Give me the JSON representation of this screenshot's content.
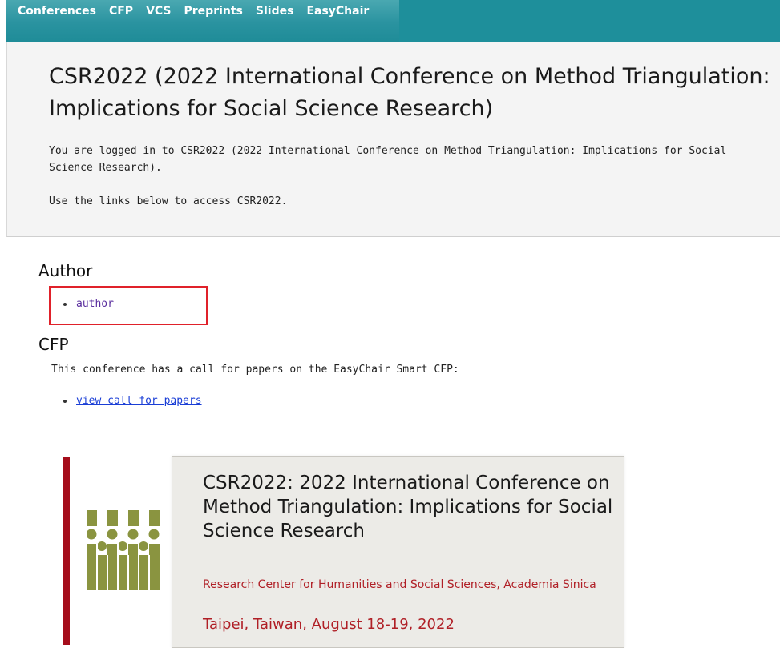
{
  "nav": {
    "items": [
      {
        "label": "Conferences"
      },
      {
        "label": "CFP"
      },
      {
        "label": "VCS"
      },
      {
        "label": "Preprints"
      },
      {
        "label": "Slides"
      },
      {
        "label": "EasyChair"
      }
    ]
  },
  "header": {
    "title": "CSR2022 (2022 International Conference on Method Triangulation: Implications for Social Science Research)",
    "intro": "You are logged in to CSR2022 (2022 International Conference on Method Triangulation: Implications for Social Science Research).",
    "intro2": "Use the links below to access CSR2022."
  },
  "author_section": {
    "heading": "Author",
    "link": "author"
  },
  "cfp_section": {
    "heading": "CFP",
    "description": "This conference has a call for papers on the EasyChair Smart CFP:",
    "link": "view call for papers"
  },
  "card": {
    "title": "CSR2022: 2022 International Conference on Method Triangulation: Implications for Social Science Research",
    "organization": "Research Center for Humanities and Social Sciences, Academia Sinica",
    "place_date": "Taipei, Taiwan, August 18-19, 2022"
  },
  "colors": {
    "topbar": "#1e8f9b",
    "accent_red": "#b01f26",
    "logo_green": "#8a9440",
    "highlight": "#e0212a"
  }
}
